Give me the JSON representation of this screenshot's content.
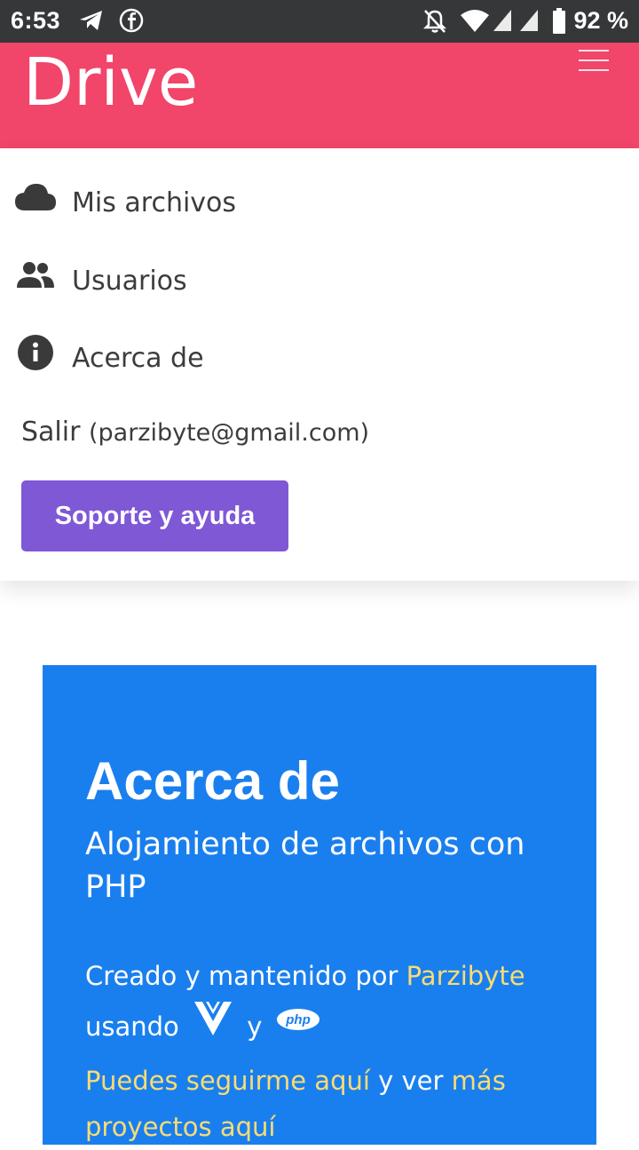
{
  "status_bar": {
    "time": "6:53",
    "battery_percent": "92 %",
    "icons": [
      "telegram-icon",
      "facebook-icon",
      "notifications-off-icon",
      "wifi-icon",
      "signal-icon",
      "signal-icon",
      "battery-icon"
    ]
  },
  "header": {
    "brand": "Drive",
    "background_color": "#f1456a"
  },
  "menu": {
    "items": [
      {
        "label": "Mis archivos",
        "icon": "cloud-icon"
      },
      {
        "label": "Usuarios",
        "icon": "users-icon"
      },
      {
        "label": "Acerca de",
        "icon": "info-icon"
      }
    ],
    "logout_label": "Salir",
    "logout_email": "(parzibyte@gmail.com)",
    "support_button": "Soporte y ayuda",
    "support_button_color": "#7f58d6"
  },
  "about": {
    "title": "Acerca de",
    "subtitle": "Alojamiento de archivos con PHP",
    "created_prefix": "Creado y mantenido por ",
    "author_link": "Parzibyte",
    "using_word": "usando",
    "and_word": "y",
    "follow_link": "Puedes seguirme aquí",
    "and_see": " y ver ",
    "projects_link": "más proyectos aquí",
    "php_logo_text": "php",
    "background_color": "#1a7fee",
    "link_color": "#f9dc74"
  }
}
